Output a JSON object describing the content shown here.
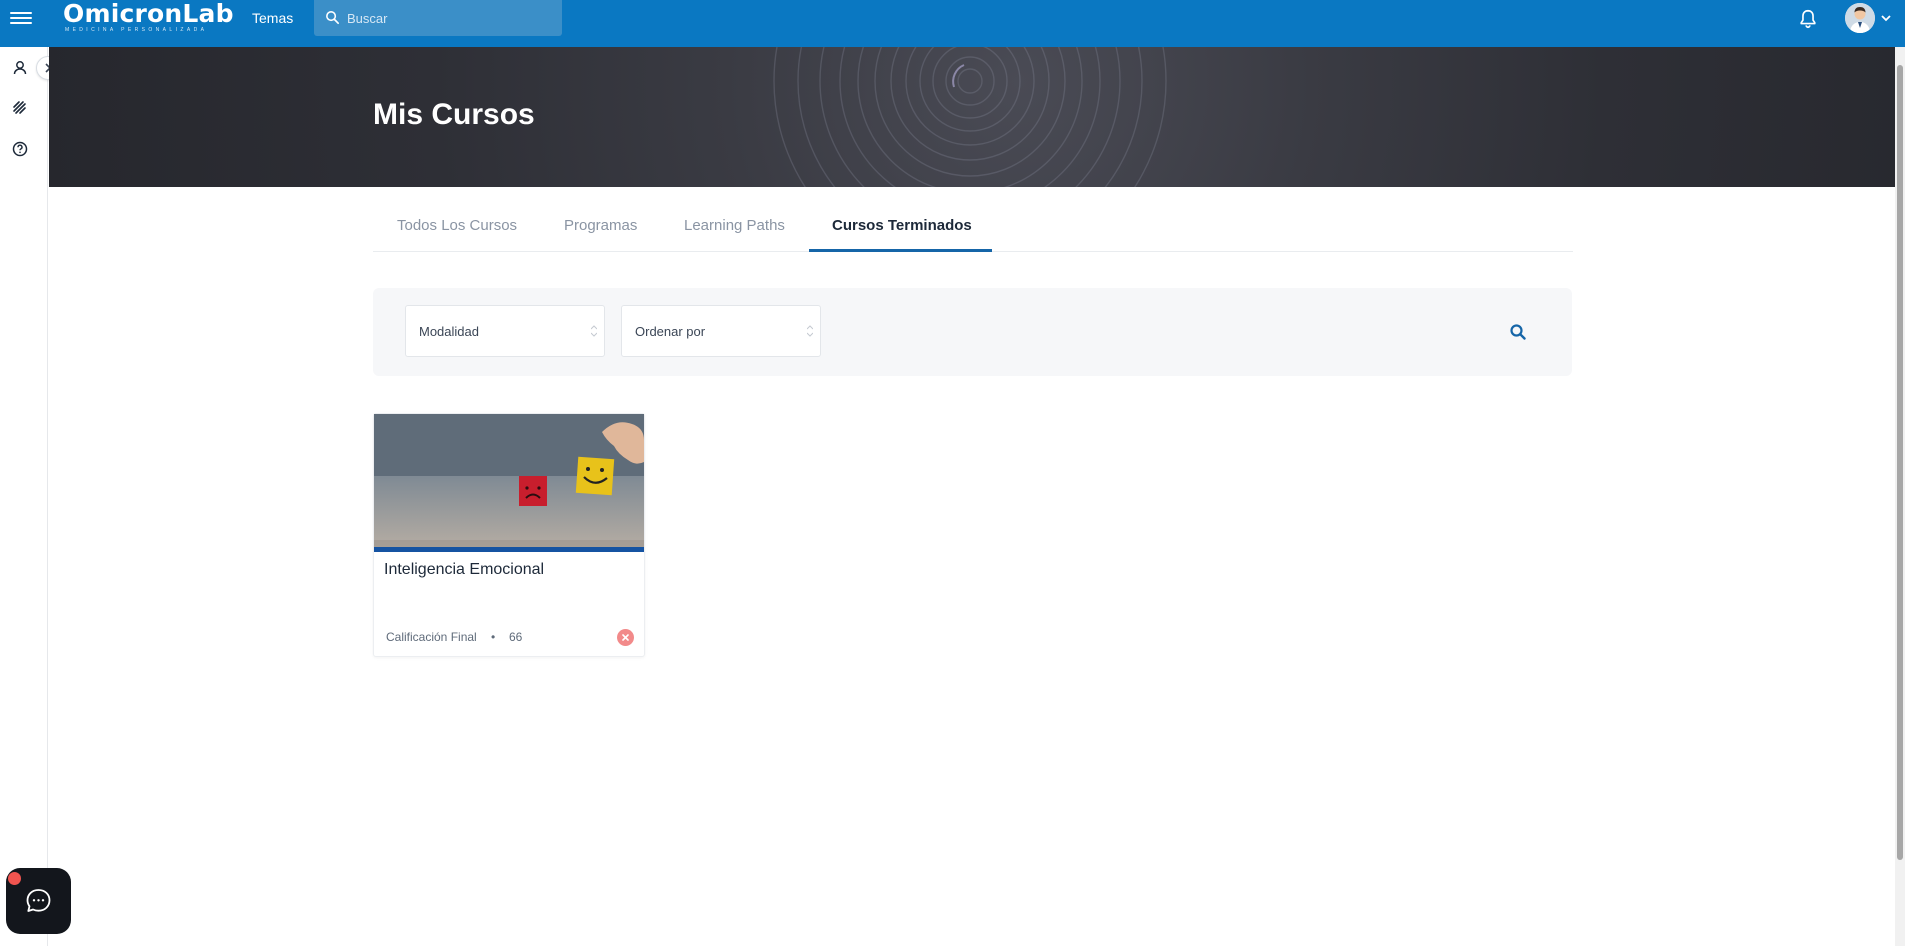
{
  "app": {
    "logo_text": "OmicronLab",
    "logo_tagline": "MEDICINA PERSONALIZADA"
  },
  "topbar": {
    "nav_temas": "Temas",
    "search_placeholder": "Buscar"
  },
  "hero": {
    "title": "Mis Cursos"
  },
  "tabs": [
    {
      "label": "Todos Los Cursos",
      "active": false
    },
    {
      "label": "Programas",
      "active": false
    },
    {
      "label": "Learning Paths",
      "active": false
    },
    {
      "label": "Cursos Terminados",
      "active": true
    }
  ],
  "filters": {
    "modalidad": "Modalidad",
    "ordenar": "Ordenar por"
  },
  "courses": [
    {
      "title": "Inteligencia Emocional",
      "grade_label": "Calificación Final",
      "separator": "•",
      "grade_value": "66",
      "status": "failed",
      "status_color": "#f28a8a",
      "accent_color": "#1553a2"
    }
  ],
  "colors": {
    "topbar": "#0a78c2",
    "tab_active_underline": "#1565a8",
    "chat_badge": "#f0544f"
  },
  "icons": {
    "menu": "hamburger-icon",
    "search": "search-icon",
    "notifications": "bell-icon",
    "profile": "user-icon",
    "courses": "layers-icon",
    "help": "help-icon",
    "expand": "chevron-right-icon",
    "chat": "chat-icon"
  }
}
